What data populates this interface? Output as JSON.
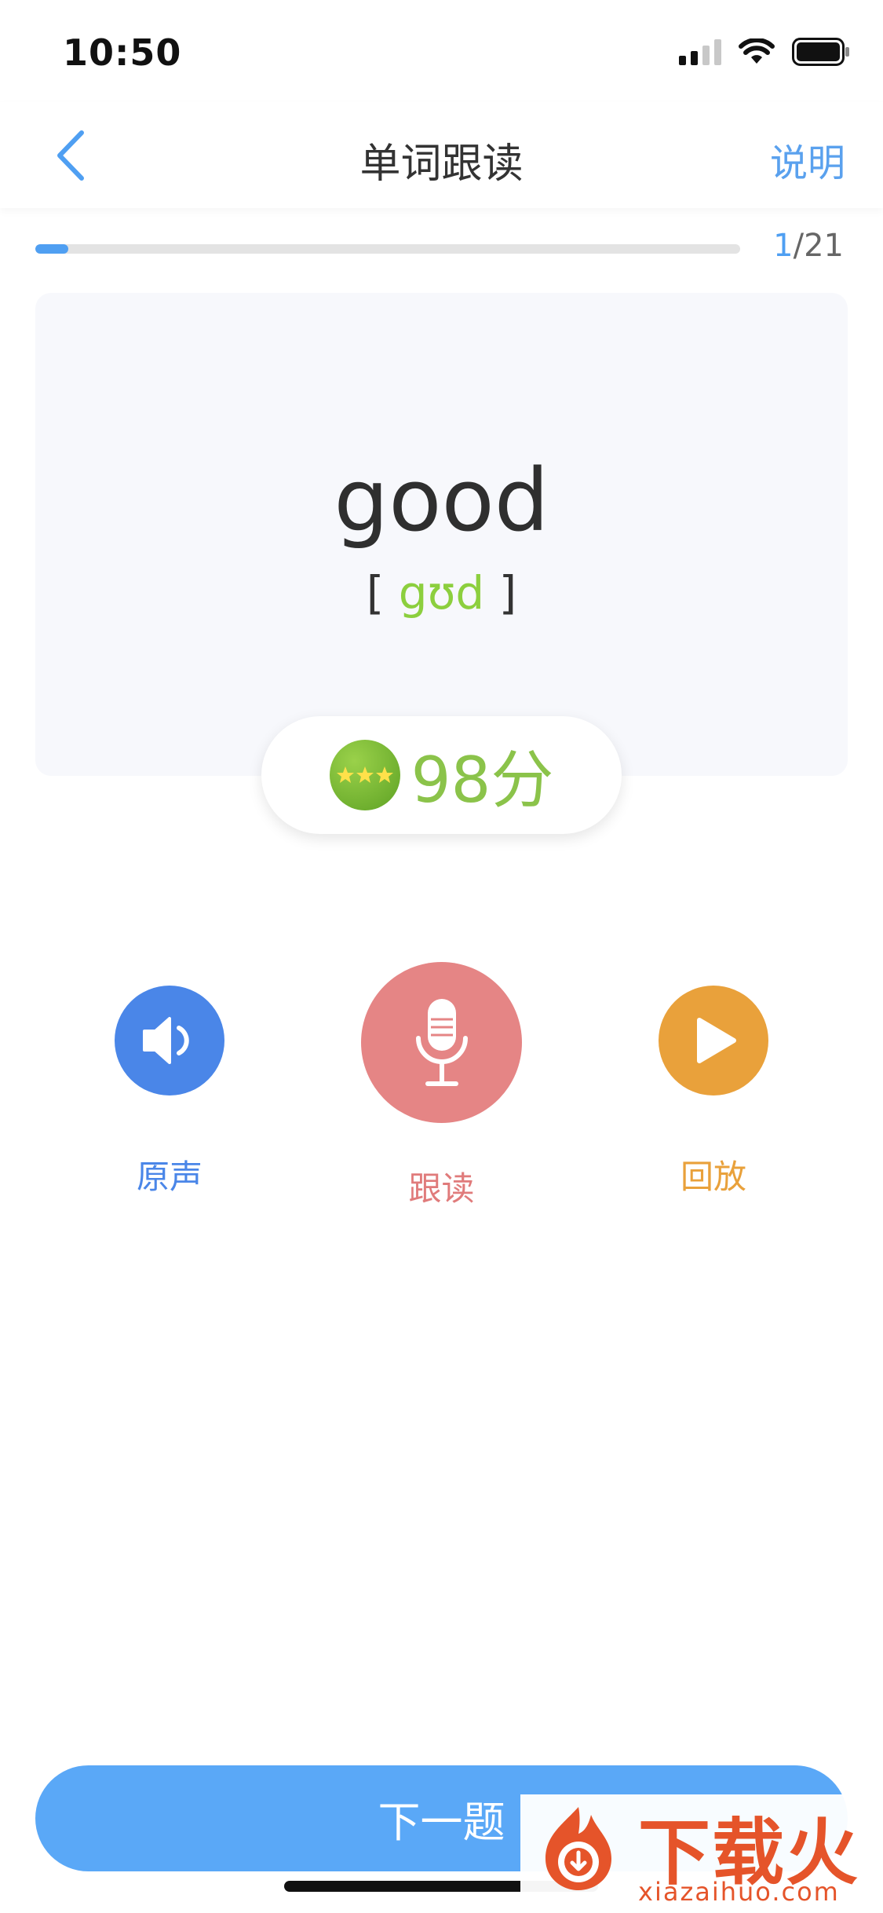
{
  "status_bar": {
    "time": "10:50"
  },
  "nav": {
    "title": "单词跟读",
    "help": "说明"
  },
  "progress": {
    "current": "1",
    "total": "/21",
    "fraction": 0.047
  },
  "word": {
    "text": "good",
    "bracket_open": "[ ",
    "ipa": "gʊd",
    "bracket_close": " ]"
  },
  "score": {
    "value": "98分",
    "stars": 3
  },
  "controls": {
    "original": {
      "label": "原声",
      "color": "#4a86e8"
    },
    "follow": {
      "label": "跟读",
      "color": "#e58585"
    },
    "playback": {
      "label": "回放",
      "color": "#e9a13b"
    }
  },
  "next_button": {
    "label": "下一题"
  },
  "watermark": {
    "text": "下载火",
    "domain": "xiazaihuo.com"
  }
}
